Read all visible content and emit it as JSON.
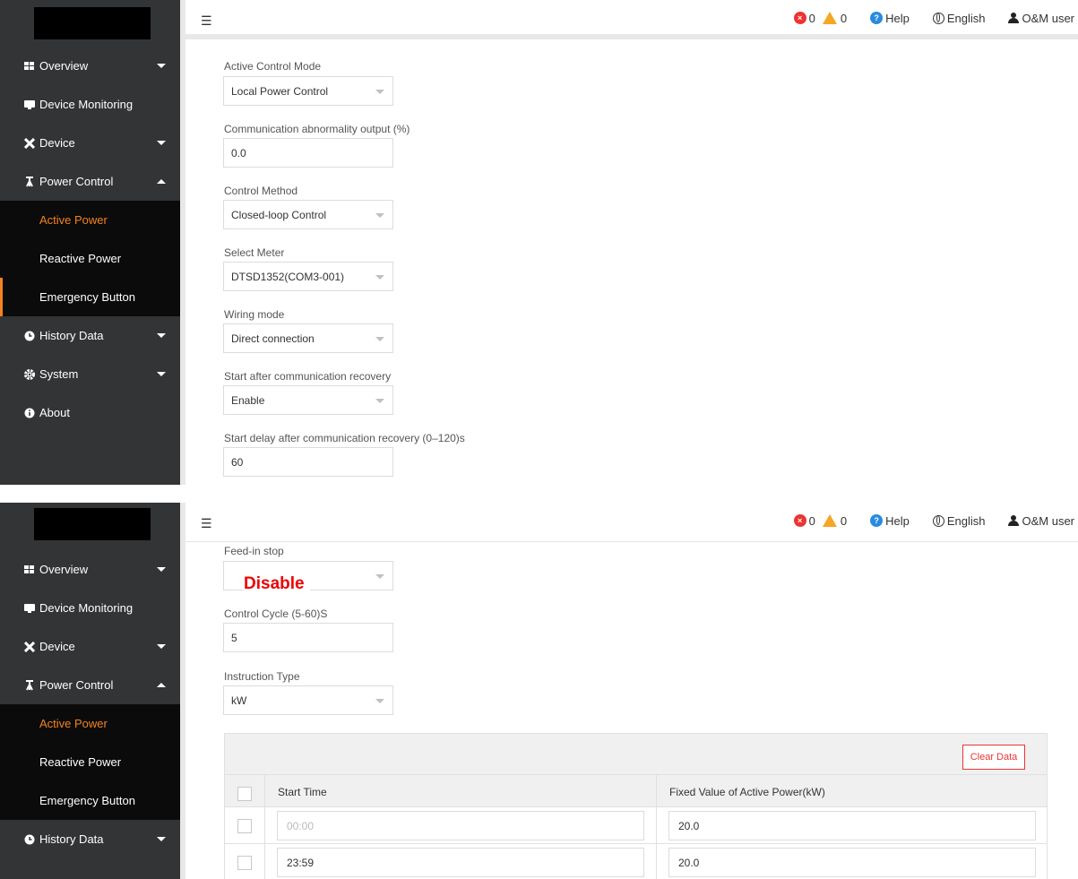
{
  "topbar": {
    "error_count": "0",
    "warning_count": "0",
    "help_label": "Help",
    "language_label": "English",
    "user_label": "O&M user"
  },
  "sidebar": {
    "menu": [
      {
        "label": "Overview",
        "icon": "grid-icon"
      },
      {
        "label": "Device Monitoring",
        "icon": "monitor-icon"
      },
      {
        "label": "Device",
        "icon": "tools-icon"
      },
      {
        "label": "Power Control",
        "icon": "tower-icon"
      }
    ],
    "submenu": [
      {
        "label": "Active Power",
        "active": true
      },
      {
        "label": "Reactive Power"
      },
      {
        "label": "Emergency Button"
      }
    ],
    "menu_bottom": [
      {
        "label": "History Data",
        "icon": "clock-icon"
      },
      {
        "label": "System",
        "icon": "gear-icon"
      },
      {
        "label": "About",
        "icon": "info-icon"
      }
    ]
  },
  "form1": {
    "active_control_mode": {
      "label": "Active Control Mode",
      "value": "Local Power Control"
    },
    "comm_abnormal_output": {
      "label": "Communication abnormality output (%)",
      "value": "0.0"
    },
    "control_method": {
      "label": "Control Method",
      "value": "Closed-loop Control"
    },
    "select_meter": {
      "label": "Select Meter",
      "value": "DTSD1352(COM3-001)"
    },
    "wiring_mode": {
      "label": "Wiring mode",
      "value": "Direct connection"
    },
    "start_after_recovery": {
      "label": "Start after communication recovery",
      "value": "Enable"
    },
    "start_delay": {
      "label": "Start delay after communication recovery (0–120)s",
      "value": "60"
    }
  },
  "form2": {
    "feed_in_stop": {
      "label": "Feed-in stop",
      "value": "Disable"
    },
    "control_cycle": {
      "label": "Control Cycle (5-60)S",
      "value": "5"
    },
    "instruction_type": {
      "label": "Instruction Type",
      "value": "kW"
    }
  },
  "schedule_table": {
    "clear_button": "Clear Data",
    "columns": [
      "Start Time",
      "Fixed Value of Active Power(kW)"
    ],
    "rows": [
      {
        "start_time": "00:00",
        "start_time_placeholder": true,
        "value": "20.0"
      },
      {
        "start_time": "23:59",
        "value": "20.0"
      }
    ]
  },
  "colors": {
    "accent": "#f58220",
    "sidebar_bg": "#333435",
    "error": "#e33333",
    "help": "#2a8ae0",
    "warning": "#f5a623"
  }
}
